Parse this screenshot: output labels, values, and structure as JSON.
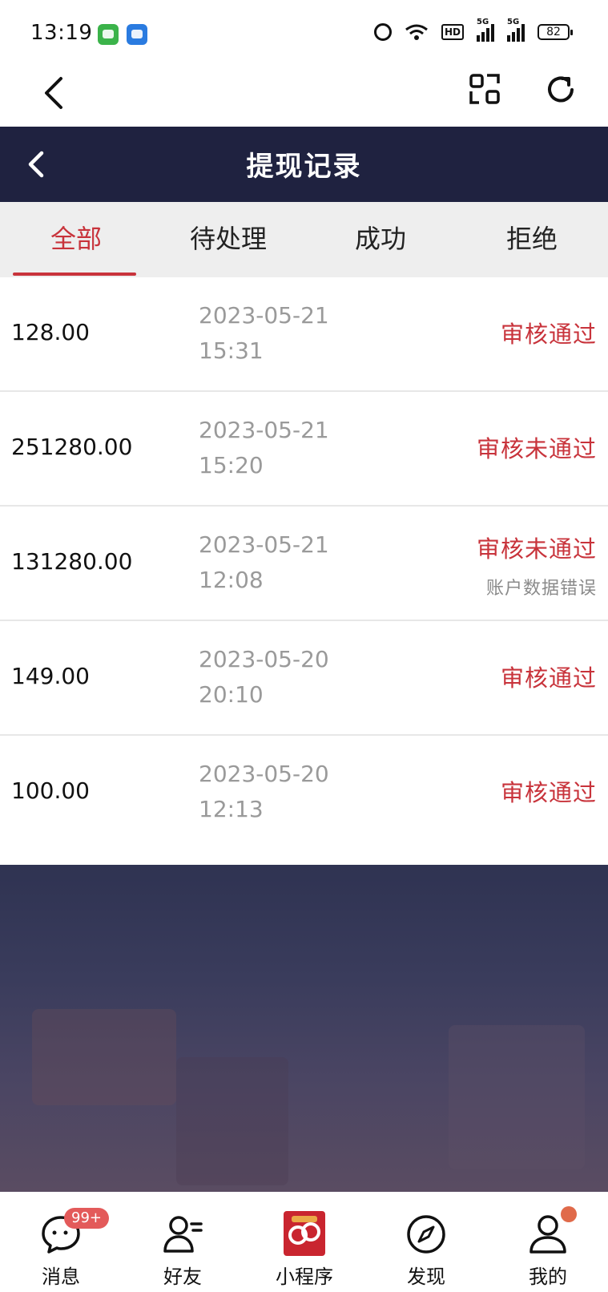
{
  "status_bar": {
    "time": "13:19",
    "battery": "82",
    "hd_label": "HD",
    "sig1_label": "5G",
    "sig2_label": "5G"
  },
  "app_bar": {
    "icons": [
      "back-arrow-icon",
      "scan-icon",
      "refresh-icon"
    ]
  },
  "header": {
    "title": "提现记录"
  },
  "tabs": [
    {
      "label": "全部",
      "active": true
    },
    {
      "label": "待处理",
      "active": false
    },
    {
      "label": "成功",
      "active": false
    },
    {
      "label": "拒绝",
      "active": false
    }
  ],
  "records": [
    {
      "amount": "128.00",
      "date": "2023-05-21",
      "time": "15:31",
      "status": "审核通过",
      "note": ""
    },
    {
      "amount": "251280.00",
      "date": "2023-05-21",
      "time": "15:20",
      "status": "审核未通过",
      "note": ""
    },
    {
      "amount": "131280.00",
      "date": "2023-05-21",
      "time": "12:08",
      "status": "审核未通过",
      "note": "账户数据错误"
    },
    {
      "amount": "149.00",
      "date": "2023-05-20",
      "time": "20:10",
      "status": "审核通过",
      "note": ""
    },
    {
      "amount": "100.00",
      "date": "2023-05-20",
      "time": "12:13",
      "status": "审核通过",
      "note": ""
    }
  ],
  "bottom_nav": [
    {
      "label": "消息",
      "badge": "99+"
    },
    {
      "label": "好友"
    },
    {
      "label": "小程序"
    },
    {
      "label": "发现"
    },
    {
      "label": "我的"
    }
  ],
  "colors": {
    "accent": "#c8333b",
    "header_bg": "#1f2240",
    "tab_bg": "#eeeeee"
  }
}
